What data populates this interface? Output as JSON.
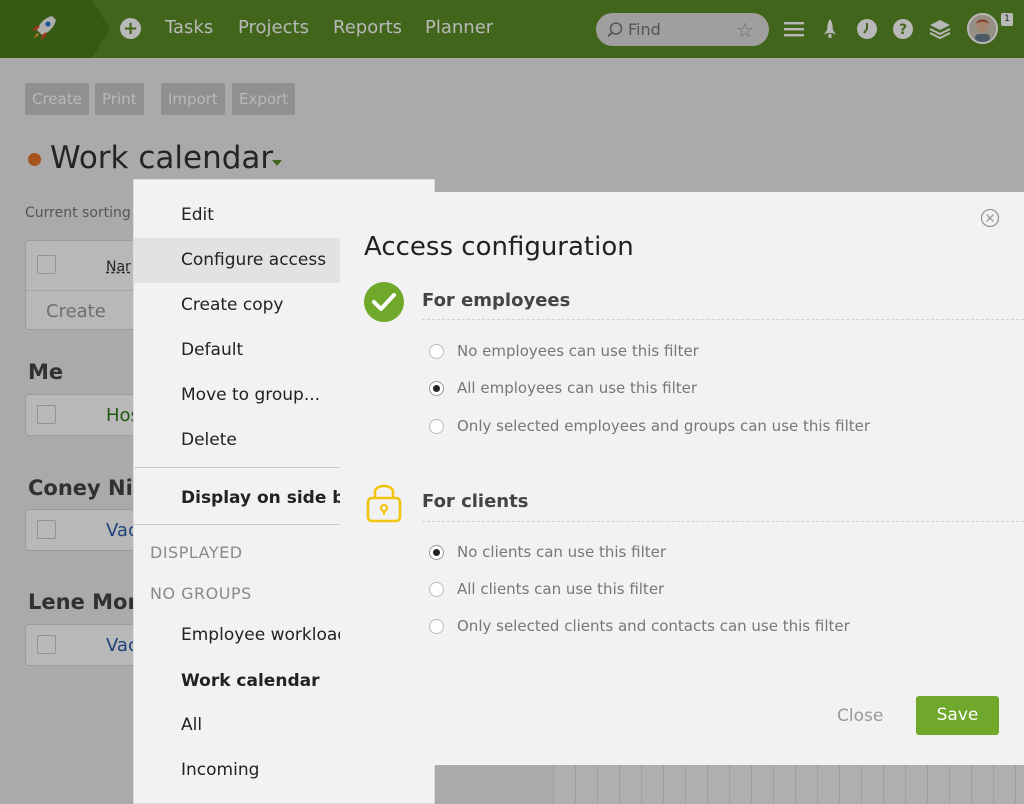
{
  "topbar": {
    "nav": [
      "Tasks",
      "Projects",
      "Reports",
      "Planner"
    ],
    "search_placeholder": "Find",
    "notification_count": "1"
  },
  "toolbar": {
    "buttons": [
      "Create",
      "Print",
      "Import",
      "Export"
    ]
  },
  "page": {
    "title": "Work calendar",
    "sorting_label": "Current sorting",
    "table_header_partial": "Nar",
    "create_row_label": "Create",
    "groups": [
      {
        "title": "Me",
        "row_text": "Hos"
      },
      {
        "title": "Coney Nik",
        "row_text": "Vac"
      },
      {
        "title": "Lene Morg",
        "row_text": "Vac"
      }
    ]
  },
  "context_menu": {
    "items": [
      "Edit",
      "Configure access",
      "Create copy",
      "Default",
      "Move to group...",
      "Delete"
    ],
    "display_on_side_bar": "Display on side bar",
    "section_displayed": "DISPLAYED",
    "section_no_groups": "NO GROUPS",
    "filters": [
      "Employee workload",
      "Work calendar",
      "All",
      "Incoming"
    ]
  },
  "dialog": {
    "title": "Access configuration",
    "employees": {
      "title": "For employees",
      "options": [
        "No employees can use this filter",
        "All employees can use this filter",
        "Only selected employees and groups can use this filter"
      ],
      "selected": 1
    },
    "clients": {
      "title": "For clients",
      "options": [
        "No clients can use this filter",
        "All clients can use this filter",
        "Only selected clients and contacts can use this filter"
      ],
      "selected": 0
    },
    "close_label": "Close",
    "save_label": "Save"
  },
  "colors": {
    "brand_green": "#5b8c24",
    "save_green": "#6fa82a",
    "lock_yellow": "#f1c40f",
    "check_green": "#6fa82a"
  }
}
